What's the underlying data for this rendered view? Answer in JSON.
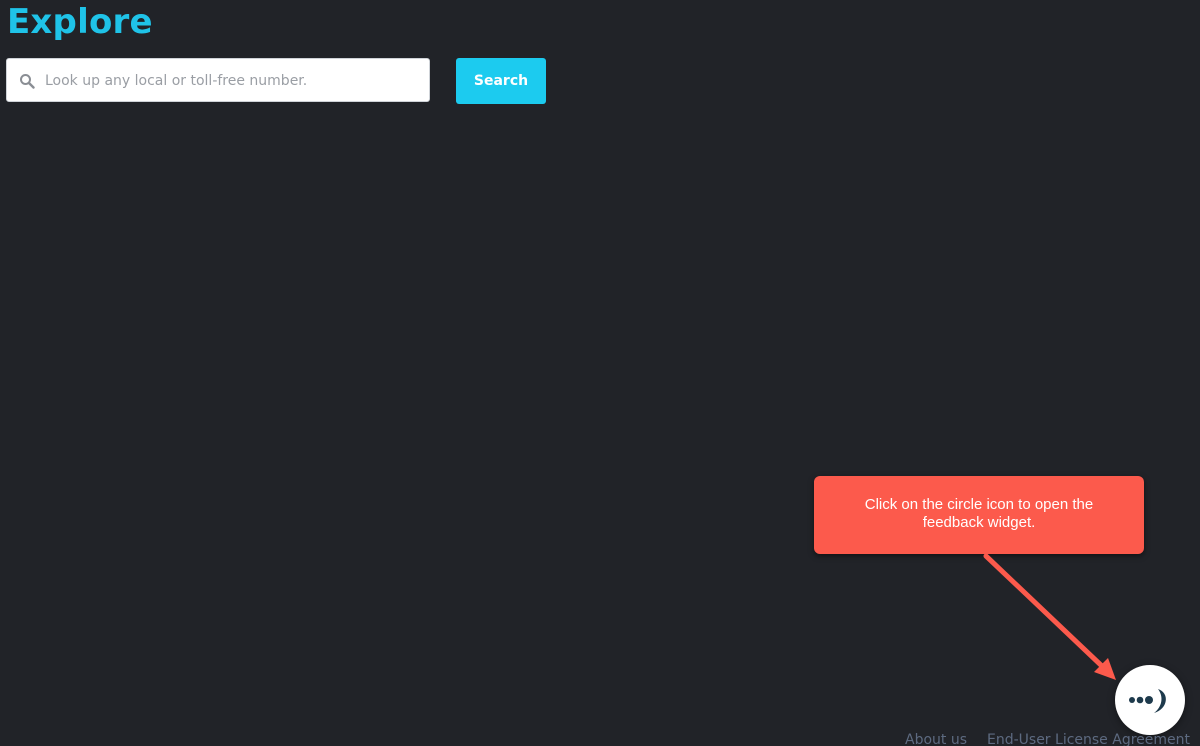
{
  "page": {
    "title": "Explore"
  },
  "search": {
    "placeholder": "Look up any local or toll-free number.",
    "value": "",
    "button_label": "Search",
    "icon": "search-icon"
  },
  "tooltip": {
    "text": "Click on the circle icon to open the feedback widget."
  },
  "feedback": {
    "icon": "feedback-icon"
  },
  "footer": {
    "links": [
      {
        "label": "About us"
      },
      {
        "label": "End-User License Agreement"
      }
    ]
  },
  "colors": {
    "background": "#212328",
    "accent": "#1fc3e8",
    "tooltip": "#fc5a4c",
    "footer_link": "#5d6a80"
  }
}
